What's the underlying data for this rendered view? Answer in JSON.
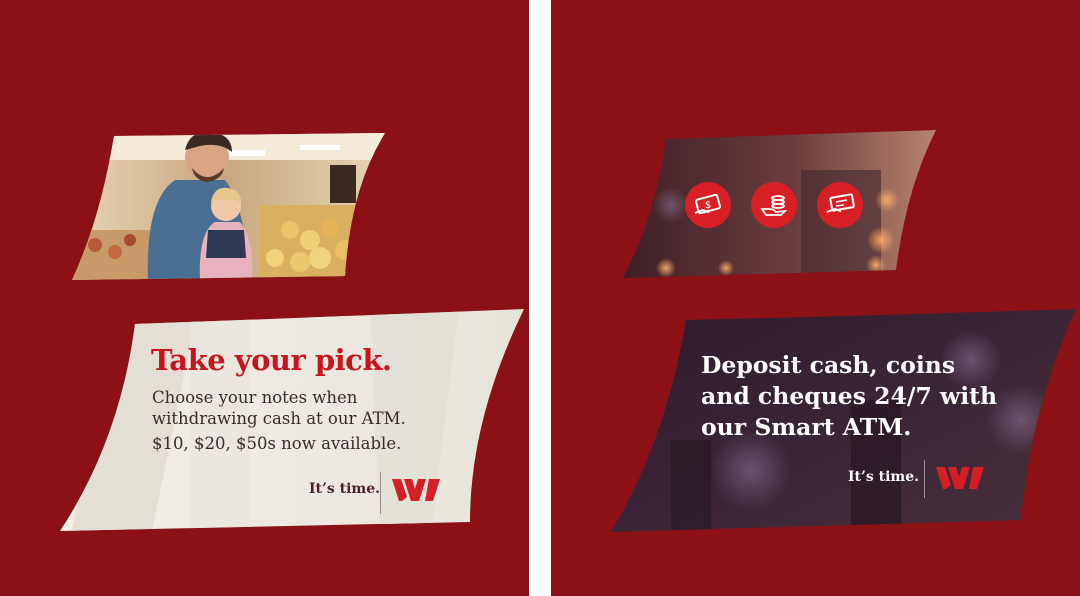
{
  "left_ad": {
    "headline": "Take your pick.",
    "body": "Choose your notes when withdrawing cash at our ATM.",
    "note_info": "$10, $20, $50s now available.",
    "tagline": "It’s time."
  },
  "right_ad": {
    "headline": "Deposit cash, coins and cheques 24/7 with our Smart ATM.",
    "tagline": "It’s time.",
    "icons": [
      "cash-deposit-icon",
      "coins-deposit-icon",
      "cheque-deposit-icon"
    ]
  },
  "colors": {
    "brand_red": "#c8141e",
    "background": "#8b1116",
    "icon_red": "#d91f26"
  }
}
